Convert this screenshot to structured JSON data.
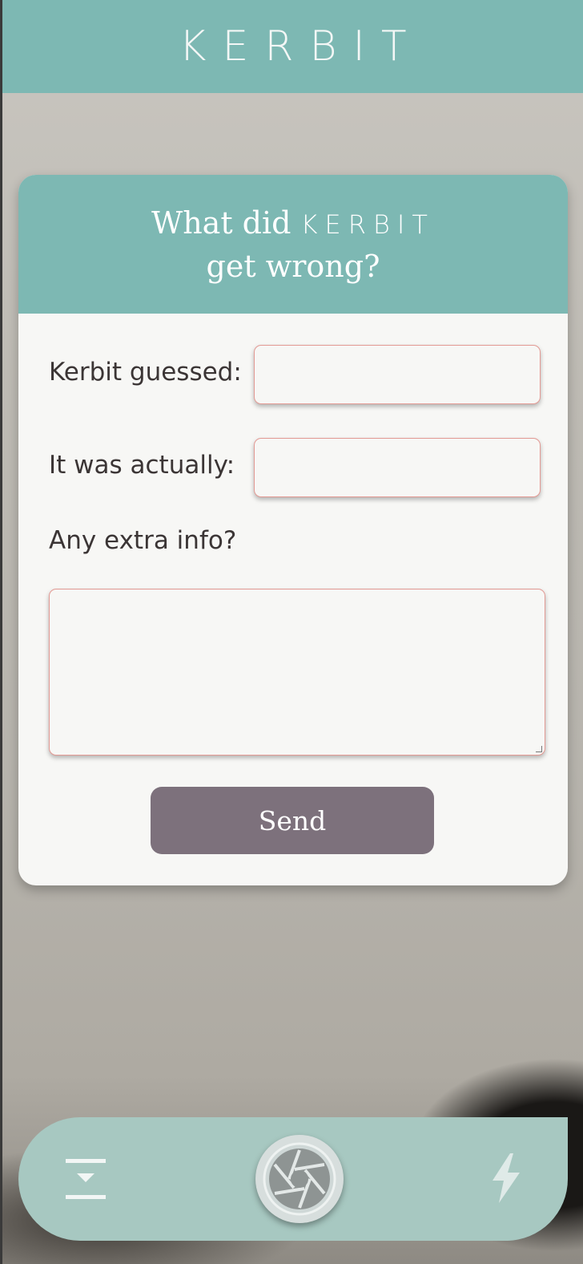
{
  "app": {
    "brand": "KERBIT"
  },
  "feedback": {
    "title_line1": "What did",
    "title_brand": "KERBIT",
    "title_line2": "get wrong?",
    "guessed_label": "Kerbit guessed:",
    "guessed_value": "",
    "actual_label": "It was actually:",
    "actual_value": "",
    "extra_label": "Any extra info?",
    "extra_value": "",
    "send_label": "Send"
  },
  "toolbar": {
    "left_icon": "download-icon",
    "center_icon": "camera-shutter-icon",
    "right_icon": "flash-icon"
  },
  "colors": {
    "accent": "#7db8b3",
    "card": "#f7f7f5",
    "field_border": "#e39a94",
    "button": "#7d717c",
    "toolbar": "#a7c8c1"
  }
}
